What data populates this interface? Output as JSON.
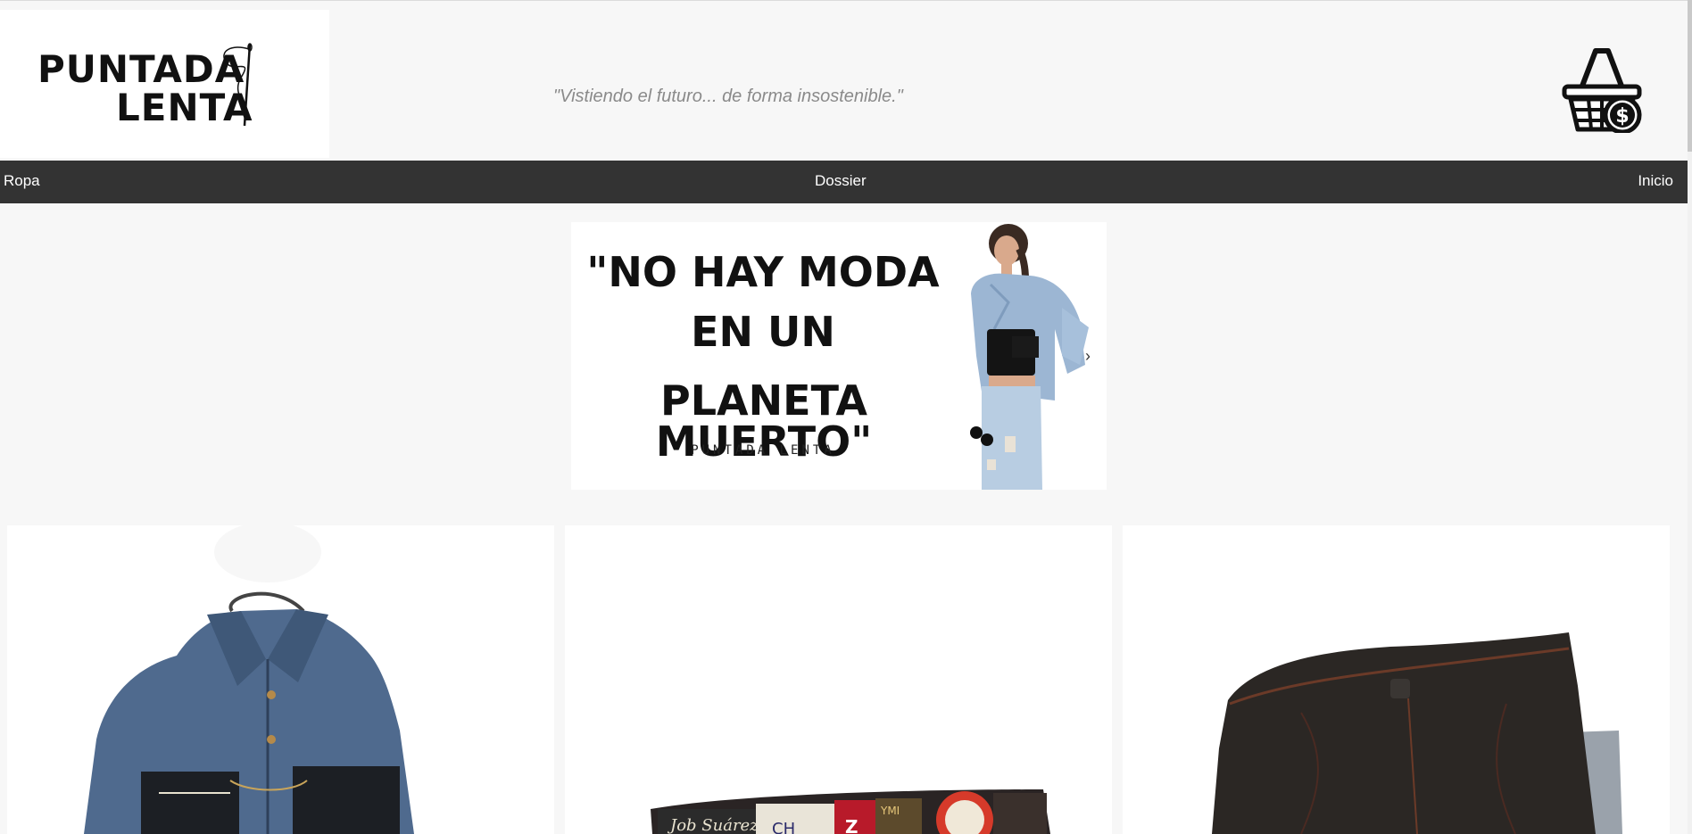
{
  "header": {
    "logo_line1": "PUNTADA",
    "logo_line2": "LENTA",
    "tagline": "\"Vistiendo el futuro... de forma insostenible.\"",
    "cart_icon": "shopping-basket-dollar-icon"
  },
  "nav": {
    "items": [
      {
        "label": "Ropa"
      },
      {
        "label": "Dossier"
      },
      {
        "label": "Inicio"
      }
    ]
  },
  "banner": {
    "line1": "\"NO HAY MODA",
    "line2": "EN UN",
    "line3": "PLANETA MUERTO\"",
    "brand": "PUNTADA LENTA",
    "next_icon": "chevron-right-icon"
  },
  "products": [
    {
      "image": "denim-jacket-image"
    },
    {
      "image": "patchwork-labels-image"
    },
    {
      "image": "dark-jeans-image"
    }
  ],
  "colors": {
    "navbar": "#333333",
    "background": "#f7f7f7",
    "tagline": "#8a8a8a"
  }
}
